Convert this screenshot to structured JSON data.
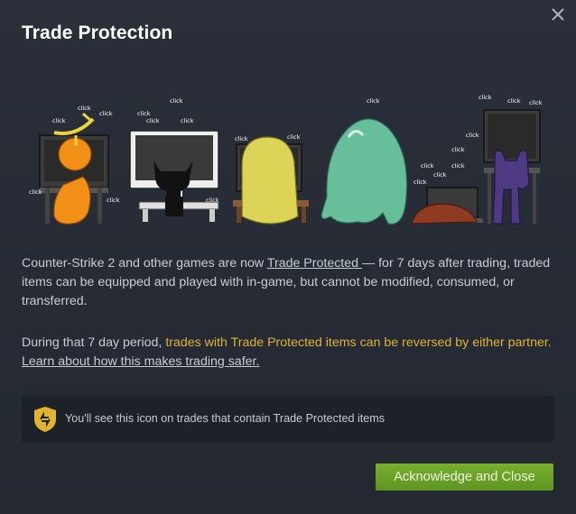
{
  "dialog": {
    "title": "Trade Protection",
    "close_icon": "close-icon",
    "paragraph1": {
      "before_link": "Counter-Strike 2 and other games are now ",
      "link": "Trade Protected ",
      "after_link": "— for 7 days after trading, traded items can be equipped and played with in-game, but cannot be modified, consumed, or transferred."
    },
    "paragraph2": {
      "before_highlight": "During that 7 day period, ",
      "highlight": "trades with Trade Protected items can be reversed by either partner.",
      "link": "Learn about how this makes trading safer."
    },
    "info": {
      "icon": "trade-protected-shield-icon",
      "text": "You'll see this icon on trades that contain Trade Protected items"
    },
    "acknowledge_button": "Acknowledge and Close",
    "illustration": {
      "click_label": "click"
    }
  },
  "colors": {
    "background": "#262b35",
    "highlight": "#e0b431",
    "button": "#6ba42a",
    "info_box": "#1d2128"
  }
}
